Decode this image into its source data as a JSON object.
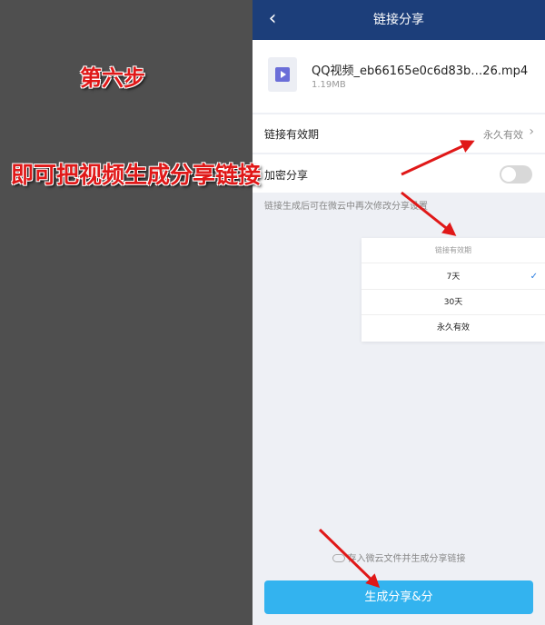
{
  "annotations": {
    "step_title": "第六步",
    "step_caption": "即可把视频生成分享链接"
  },
  "header": {
    "title": "链接分享"
  },
  "file": {
    "name": "QQ视频_eb66165e0c6d83b…26.mp4",
    "size": "1.19MB"
  },
  "settings": {
    "expiry_label": "链接有效期",
    "expiry_value": "永久有效",
    "encrypt_label": "加密分享",
    "hint": "链接生成后可在微云中再次修改分享设置"
  },
  "dropdown": {
    "title": "链接有效期",
    "options": [
      "7天",
      "30天",
      "永久有效"
    ],
    "selected": "7天",
    "check_mark": "✓"
  },
  "footer": {
    "save_note": "存入微云文件并生成分享链接",
    "generate_button": "生成分享&分"
  },
  "colors": {
    "header_bg": "#1c3e7a",
    "button_bg": "#33b3ef",
    "annotation_red": "#e01818",
    "check_blue": "#2a7de1"
  }
}
